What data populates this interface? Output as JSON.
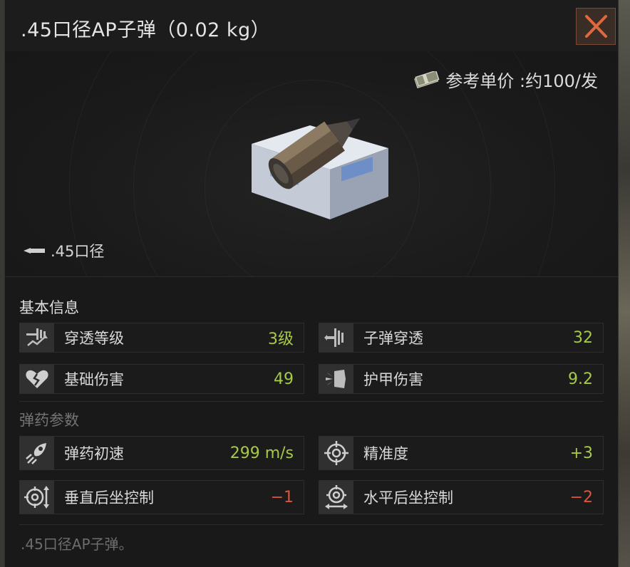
{
  "window": {
    "title": ".45口径AP子弹（0.02 kg）",
    "accent_close": "#e0683c"
  },
  "hero": {
    "price_label": "参考单价 :约100/发",
    "caliber_label": ".45口径",
    "item_image": "45-ap-ammo-box"
  },
  "basic_info": {
    "heading": "基本信息",
    "stats": [
      {
        "label": "穿透等级",
        "value": "3级",
        "icon": "penetration-level-icon"
      },
      {
        "label": "子弹穿透",
        "value": "32",
        "icon": "bullet-penetration-icon"
      },
      {
        "label": "基础伤害",
        "value": "49",
        "icon": "broken-heart-icon"
      },
      {
        "label": "护甲伤害",
        "value": "9.2",
        "icon": "armor-damage-icon"
      }
    ]
  },
  "ammo_params": {
    "heading": "弹药参数",
    "stats": [
      {
        "label": "弹药初速",
        "value": "299 m/s",
        "icon": "muzzle-velocity-icon"
      },
      {
        "label": "精准度",
        "value": "+3",
        "icon": "crosshair-icon"
      },
      {
        "label": "垂直后坐控制",
        "value": "−1",
        "icon": "vertical-recoil-icon"
      },
      {
        "label": "水平后坐控制",
        "value": "−2",
        "icon": "horizontal-recoil-icon"
      }
    ]
  },
  "description": ".45口径AP子弹。",
  "colors": {
    "positive": "#a6c94a",
    "negative": "#d9553e",
    "heading": "#dedede",
    "heading_dim": "#747474"
  }
}
